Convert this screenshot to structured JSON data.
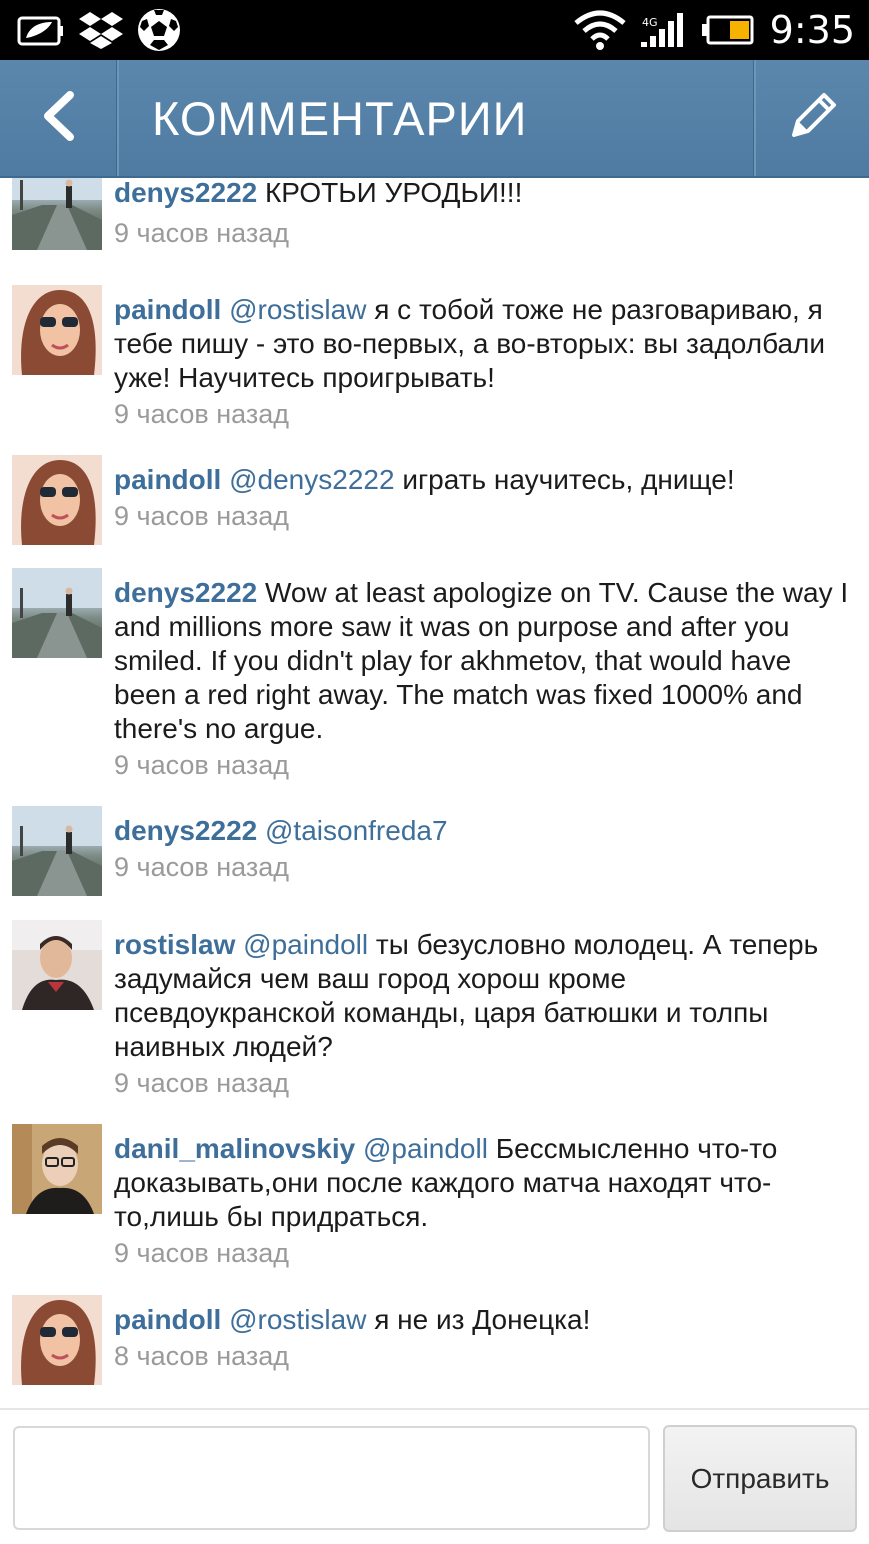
{
  "status_bar": {
    "time": "9:35",
    "left_icons": [
      "battery-saver-icon",
      "dropbox-icon",
      "soccer-ball-icon"
    ],
    "right_icons": [
      "wifi-icon",
      "signal-icon",
      "battery-icon"
    ]
  },
  "header": {
    "title": "КОММЕНТАРИИ",
    "back_icon": "chevron-left-icon",
    "edit_icon": "pencil-icon",
    "background": "#5b87ad"
  },
  "comments": [
    {
      "username": "denys2222",
      "mention": "",
      "text": " КРОТЬИ УРОДЬИ!!!",
      "time": "9 часов назад",
      "avatar": "street-avatar"
    },
    {
      "username": "paindoll",
      "mention": " @rostislaw",
      "text": " я с тобой тоже не разговариваю, я тебе пишу - это во-первых, а во-вторых: вы задолбали уже! Научитесь проигрывать!",
      "time": "9 часов назад",
      "avatar": "girl-avatar"
    },
    {
      "username": "paindoll",
      "mention": " @denys2222",
      "text": " играть научитесь, днище!",
      "time": "9 часов назад",
      "avatar": "girl-avatar"
    },
    {
      "username": "denys2222",
      "mention": "",
      "text": " Wow at least apologize on TV. Cause the way I and millions more saw it was on purpose and after you smiled. If you didn't play for akhmetov, that would have been a red right away. The match was fixed 1000% and there's no argue.",
      "time": "9 часов назад",
      "avatar": "street-avatar"
    },
    {
      "username": "denys2222",
      "mention": " @taisonfreda7",
      "text": "",
      "time": "9 часов назад",
      "avatar": "street-avatar"
    },
    {
      "username": "rostislaw",
      "mention": " @paindoll",
      "text": " ты безусловно молодец. А теперь задумайся чем ваш город хорош кроме псевдоукранской команды, царя батюшки и толпы наивных людей?",
      "time": "9 часов назад",
      "avatar": "man-avatar"
    },
    {
      "username": "danil_malinovskiy",
      "mention": " @paindoll",
      "text": " Бессмысленно что-то доказывать,они после каждого матча находят что-то,лишь бы придраться.",
      "time": "9 часов назад",
      "avatar": "glasses-man-avatar"
    },
    {
      "username": "paindoll",
      "mention": " @rostislaw",
      "text": " я не из Донецка!",
      "time": "8 часов назад",
      "avatar": "girl-avatar"
    }
  ],
  "composer": {
    "input_value": "",
    "input_placeholder": "",
    "send_label": "Отправить"
  },
  "colors": {
    "accent": "#3e6e9a",
    "timestamp": "#9a9a9a",
    "header": "#5b87ad"
  }
}
